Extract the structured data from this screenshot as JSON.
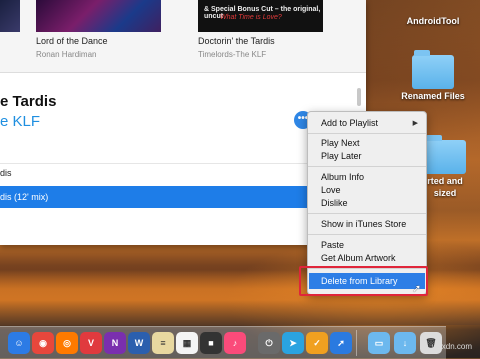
{
  "albums": [
    {
      "title": "Lord of the Dance",
      "artist": "Ronan Hardiman"
    },
    {
      "title": "Doctorin' the Tardis",
      "artist": "Timelords-The KLF"
    }
  ],
  "album_art": {
    "line1": "& Special Bonus Cut – the original, uncut",
    "line2": "What Time is Love?"
  },
  "song": {
    "title": "e Tardis",
    "artist": "e KLF",
    "more_glyph": "•••"
  },
  "tracks": [
    "dis",
    "dis (12' mix)"
  ],
  "menu": {
    "add_to_playlist": "Add to Playlist",
    "play_next": "Play Next",
    "play_later": "Play Later",
    "album_info": "Album Info",
    "love": "Love",
    "dislike": "Dislike",
    "show_in_store": "Show in iTunes Store",
    "paste": "Paste",
    "get_album_artwork": "Get Album Artwork",
    "delete_from_library": "Delete from Library",
    "submenu_arrow": "▶"
  },
  "desktop": {
    "androidtool": "AndroidTool",
    "renamed_files": "Renamed Files",
    "converted_line1": "rted and",
    "converted_line2": "sized"
  },
  "dock_icons": [
    {
      "name": "finder",
      "color": "#2c7be5",
      "glyph": "☺"
    },
    {
      "name": "chrome",
      "color": "#e7473c",
      "glyph": "◉"
    },
    {
      "name": "firefox",
      "color": "#ff7a00",
      "glyph": "◎"
    },
    {
      "name": "vivaldi",
      "color": "#e03a3e",
      "glyph": "V"
    },
    {
      "name": "onenote",
      "color": "#7a2fae",
      "glyph": "N"
    },
    {
      "name": "word",
      "color": "#2b5fae",
      "glyph": "W"
    },
    {
      "name": "notes",
      "color": "#e8d8a0",
      "glyph": "≡"
    },
    {
      "name": "calendar",
      "color": "#f4f4f4",
      "glyph": "▦"
    },
    {
      "name": "dark-app",
      "color": "#333",
      "glyph": "■"
    },
    {
      "name": "itunes",
      "color": "#fa4b7a",
      "glyph": "♪"
    },
    {
      "name": "power",
      "color": "#6a6a6a",
      "glyph": "⏻"
    },
    {
      "name": "telegram",
      "color": "#2aa3e0",
      "glyph": "➤"
    },
    {
      "name": "tasks",
      "color": "#f0a020",
      "glyph": "✓"
    },
    {
      "name": "safari",
      "color": "#2a7ae0",
      "glyph": "➚"
    },
    {
      "name": "folder",
      "color": "#6cb8ee",
      "glyph": "▭"
    },
    {
      "name": "downloads",
      "color": "#6cb8ee",
      "glyph": "↓"
    },
    {
      "name": "trash",
      "color": "#dcdcdc",
      "glyph": "🗑"
    }
  ],
  "watermark": "wsxdn.com"
}
